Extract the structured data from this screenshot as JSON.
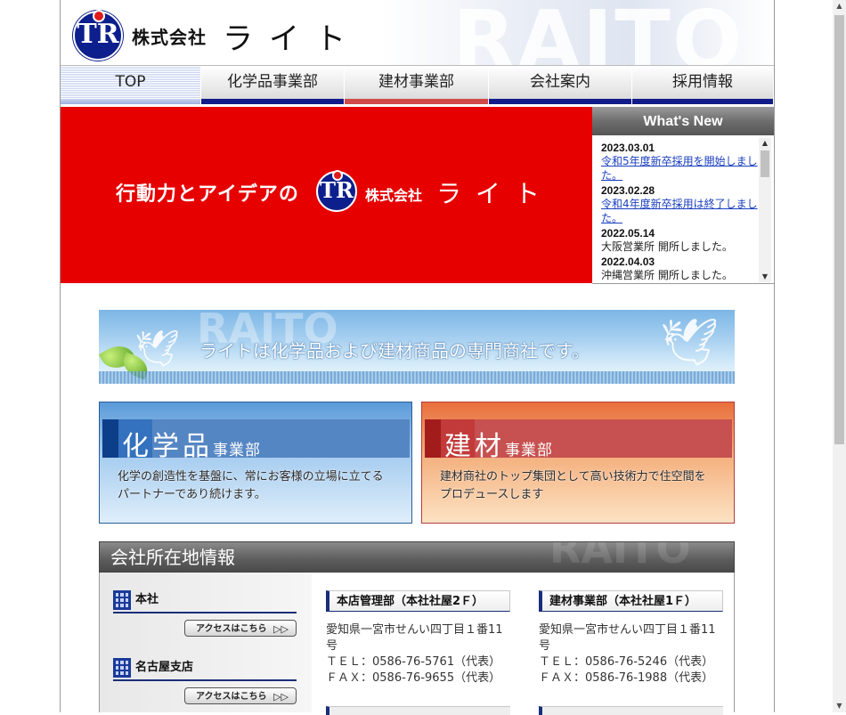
{
  "header": {
    "watermark": "RAITO",
    "company_prefix": "株式会社",
    "company_name": "ライト",
    "logo_letters": "TR"
  },
  "nav": {
    "items": [
      {
        "label": "TOP"
      },
      {
        "label": "化学品事業部"
      },
      {
        "label": "建材事業部"
      },
      {
        "label": "会社案内"
      },
      {
        "label": "採用情報"
      }
    ]
  },
  "hero": {
    "tagline": "行動力とアイデアの",
    "company_prefix": "株式会社",
    "company_name": "ライト",
    "logo_letters": "TR",
    "color": "#e60000"
  },
  "news": {
    "title": "What's New",
    "items": [
      {
        "date": "2023.03.01",
        "text": "令和5年度新卒採用を開始しました。",
        "link": true
      },
      {
        "date": "2023.02.28",
        "text": "令和4年度新卒採用は終了しました。",
        "link": true
      },
      {
        "date": "2022.05.14",
        "text": "大阪営業所 開所しました。",
        "link": false
      },
      {
        "date": "2022.04.03",
        "text": "沖縄営業所 開所しました。",
        "link": false
      }
    ]
  },
  "banner": {
    "text": "ライトは化学品および建材商品の専門商社です。",
    "watermark": "RAITO"
  },
  "divisions": {
    "chemical": {
      "title_main": "化学品",
      "title_sub": "事業部",
      "desc1": "化学の創造性を基盤に、常にお客様の立場に立てる",
      "desc2": "パートナーであり続けます。"
    },
    "building": {
      "title_main": "建材",
      "title_sub": "事業部",
      "desc1": "建材商社のトップ集団として高い技術力で住空間を",
      "desc2": "プロデュースします"
    }
  },
  "locations": {
    "title": "会社所在地情報",
    "watermark": "RAITO",
    "branches": [
      {
        "name": "本社",
        "access": "アクセスはこちら"
      },
      {
        "name": "名古屋支店",
        "access": "アクセスはこちら"
      }
    ],
    "offices": [
      {
        "name": "本店管理部（本社社屋2Ｆ）",
        "address": "愛知県一宮市せんい四丁目１番11号",
        "tel": "ＴＥＬ：0586-76-5761（代表）",
        "fax": "ＦＡＸ：0586-76-9655（代表）"
      },
      {
        "name": "建材事業部（本社社屋1Ｆ）",
        "address": "愛知県一宮市せんい四丁目１番11号",
        "tel": "ＴＥＬ：0586-76-5246（代表）",
        "fax": "ＦＡＸ：0586-76-1988（代表）"
      }
    ]
  },
  "colors": {
    "navy": "#111c88",
    "red": "#e60000",
    "link": "#1a3fbf"
  }
}
